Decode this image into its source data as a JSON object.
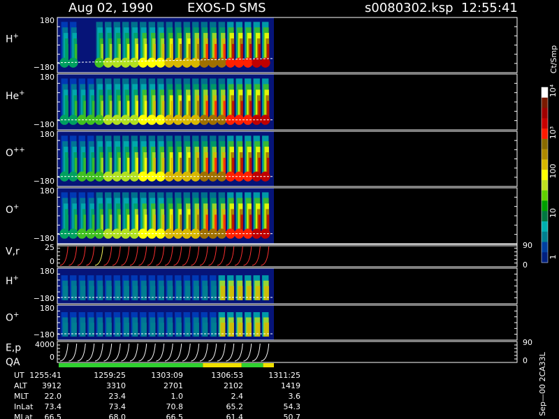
{
  "header": {
    "date": "Aug 02, 1990",
    "instrument": "EXOS-D SMS",
    "file": "s0080302.ksp",
    "time": "12:55:41"
  },
  "chart_data": {
    "type": "heatmap",
    "panels": [
      {
        "label": "H",
        "sup": "+",
        "ytop": "180",
        "ybot": "−180",
        "kind": "spectro"
      },
      {
        "label": "He",
        "sup": "+",
        "ytop": "180",
        "ybot": "−180",
        "kind": "spectro"
      },
      {
        "label": "O",
        "sup": "++",
        "ytop": "180",
        "ybot": "−180",
        "kind": "spectro"
      },
      {
        "label": "O",
        "sup": "+",
        "ytop": "180",
        "ybot": "−180",
        "kind": "spectro"
      },
      {
        "label": "V,r",
        "sup": "",
        "ytop": "25",
        "ybot": "0",
        "kind": "line",
        "rtop": "90",
        "rbot": "0"
      },
      {
        "label": "H",
        "sup": "+",
        "ytop": "180",
        "ybot": "−180",
        "kind": "spectro2"
      },
      {
        "label": "O",
        "sup": "+",
        "ytop": "180",
        "ybot": "−180",
        "kind": "spectro2"
      },
      {
        "label": "E,p",
        "sup": "",
        "label2": "QA",
        "ytop": "4000",
        "ybot": "0",
        "kind": "line",
        "rtop": "90",
        "rbot": "0"
      }
    ],
    "colorbar": {
      "unit": "Ct/Smp",
      "ticks": [
        "10⁴",
        "10³",
        "100",
        "10",
        "1"
      ],
      "colors": [
        "#ffffff",
        "#7a1a00",
        "#a00000",
        "#c80000",
        "#ff1a00",
        "#8a6a00",
        "#b08a00",
        "#d8b800",
        "#ffff00",
        "#c0e020",
        "#60d000",
        "#00a000",
        "#007840",
        "#00b0b0",
        "#008090",
        "#0040a0",
        "#002080"
      ]
    },
    "footer": {
      "rows": [
        {
          "name": "UT",
          "values": [
            "1255:41",
            "1259:25",
            "1303:09",
            "1306:53",
            "1311:25"
          ]
        },
        {
          "name": "ALT",
          "values": [
            "3912",
            "3310",
            "2701",
            "2102",
            "1419"
          ]
        },
        {
          "name": "MLT",
          "values": [
            "22.0",
            "23.4",
            "1.0",
            "2.4",
            "3.6"
          ]
        },
        {
          "name": "InLat",
          "values": [
            "73.4",
            "73.4",
            "70.8",
            "65.2",
            "54.3"
          ]
        },
        {
          "name": "MLat",
          "values": [
            "66.5",
            "68.0",
            "66.5",
            "61.4",
            "50.7"
          ]
        }
      ]
    },
    "qa_bar": [
      {
        "from": 0.0,
        "to": 0.67,
        "color": "#30d030"
      },
      {
        "from": 0.67,
        "to": 0.85,
        "color": "#f0e000"
      },
      {
        "from": 0.85,
        "to": 0.95,
        "color": "#30d030"
      },
      {
        "from": 0.95,
        "to": 1.0,
        "color": "#f0e000"
      }
    ],
    "side_label": "Sep—00 2CA33L"
  }
}
